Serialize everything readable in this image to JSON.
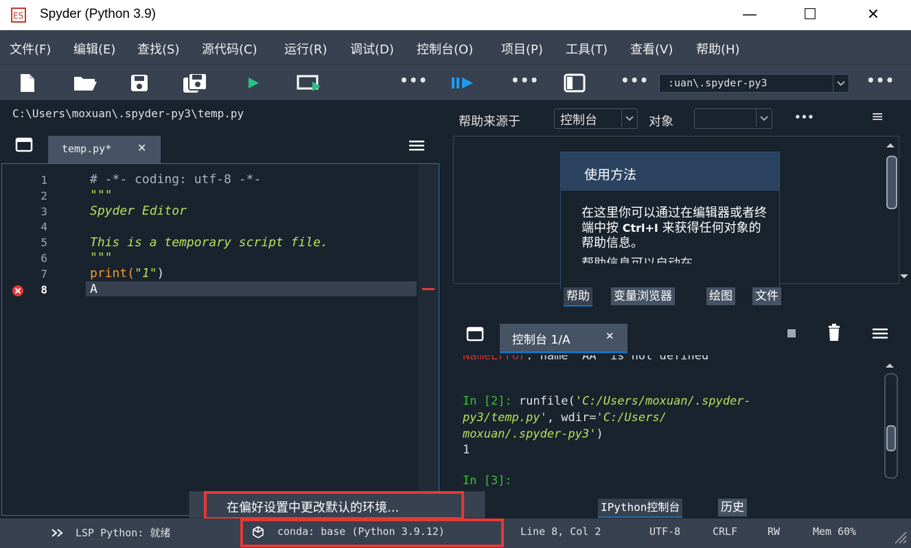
{
  "window": {
    "title": "Spyder (Python 3.9)",
    "minimize": "—",
    "maximize": "☐",
    "close": "✕"
  },
  "menu": [
    "文件(F)",
    "编辑(E)",
    "查找(S)",
    "源代码(C)",
    "运行(R)",
    "调试(D)",
    "控制台(O)",
    "项目(P)",
    "工具(T)",
    "查看(V)",
    "帮助(H)"
  ],
  "toolbar": {
    "more": "•••",
    "path_combo": ":uan\\.spyder-py3"
  },
  "editor": {
    "path": "C:\\Users\\moxuan\\.spyder-py3\\temp.py",
    "tab_label": "temp.py*",
    "tab_close": "✕",
    "line_numbers": [
      "1",
      "2",
      "3",
      "4",
      "5",
      "6",
      "7",
      "8"
    ],
    "lines": [
      "# -*- coding: utf-8 -*-",
      "\"\"\"",
      "Spyder Editor",
      "",
      "This is a temporary script file.",
      "\"\"\"",
      "print(\"1\")",
      "A"
    ],
    "print_fn": "print(",
    "print_arg": "\"1\"",
    "print_end": ")"
  },
  "help": {
    "source_label": "帮助来源于",
    "source_value": "控制台",
    "object_label": "对象",
    "object_value": "",
    "more": "•••",
    "menu": "≡",
    "usage_title": "使用方法",
    "usage_text_1": "在这里你可以通过在编辑器或者终端中按 ",
    "usage_key": "Ctrl+I",
    "usage_text_2": " 来获得任何对象的帮助信息。",
    "usage_cut": "帮助信息可以自动在",
    "tabs": [
      "帮助",
      "变量浏览器",
      "绘图",
      "文件"
    ]
  },
  "console": {
    "tab_label": "控制台 1/A",
    "tab_close": "✕",
    "error_head": "NameError",
    "error_rest": ": name 'AA' is not defined",
    "prompt2": "In [2]: ",
    "run_fn": "runfile(",
    "run_path": "'C:/Users/moxuan/.spyder-",
    "run_path2": "py3/temp.py'",
    "wdir_kw": ", wdir=",
    "wdir_val": "'C:/Users/",
    "wdir_val2": "moxuan/.spyder-py3'",
    "close_paren": ")",
    "output": "1",
    "prompt3": "In [3]:",
    "tabs": [
      "IPython控制台",
      "历史"
    ]
  },
  "status": {
    "lsp": "LSP Python: 就绪",
    "conda": "conda: base (Python 3.9.12)",
    "position": "Line 8, Col 2",
    "encoding": "UTF-8",
    "eol": "CRLF",
    "perm": "RW",
    "mem": "Mem 60%"
  },
  "tooltip": {
    "text": "在偏好设置中更改默认的环境..."
  },
  "colors": {
    "bg": "#19232d",
    "panel": "#37414f",
    "accent": "#1a72bb",
    "comment": "#a6b7c4",
    "string": "#b4e25e",
    "keyword": "#ef9a3b",
    "prompt": "#36c236",
    "error": "#d32f2f"
  }
}
